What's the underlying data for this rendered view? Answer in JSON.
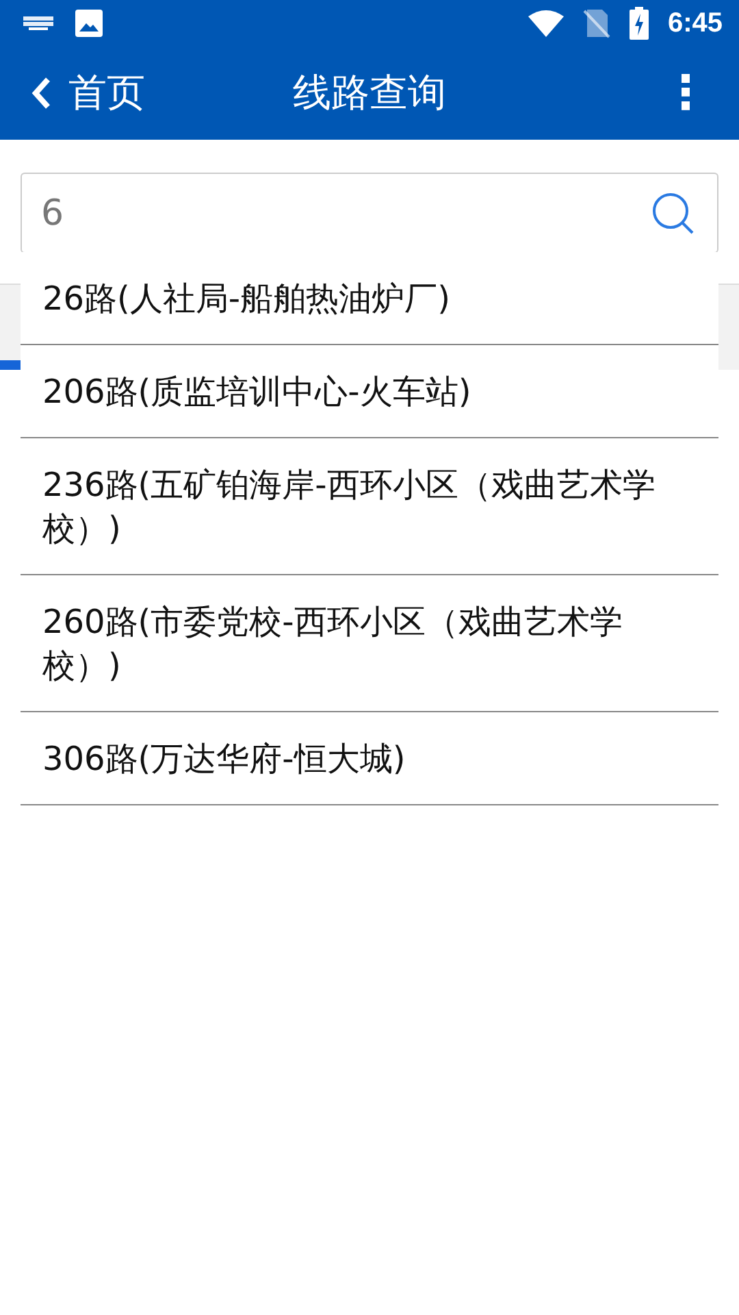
{
  "status_bar": {
    "time": "6:45"
  },
  "app_bar": {
    "back_label": "首页",
    "title": "线路查询",
    "menu_icon": "⋮"
  },
  "search": {
    "value": "6"
  },
  "suggestions": [
    {
      "label": "26路(人社局-船舶热油炉厂)"
    },
    {
      "label": "206路(质监培训中心-火车站)"
    },
    {
      "label": "236路(五矿铂海岸-西环小区（戏曲艺术学校）)"
    },
    {
      "label": "260路(市委党校-西环小区（戏曲艺术学校）)"
    },
    {
      "label": "306路(万达华府-恒大城)"
    }
  ]
}
